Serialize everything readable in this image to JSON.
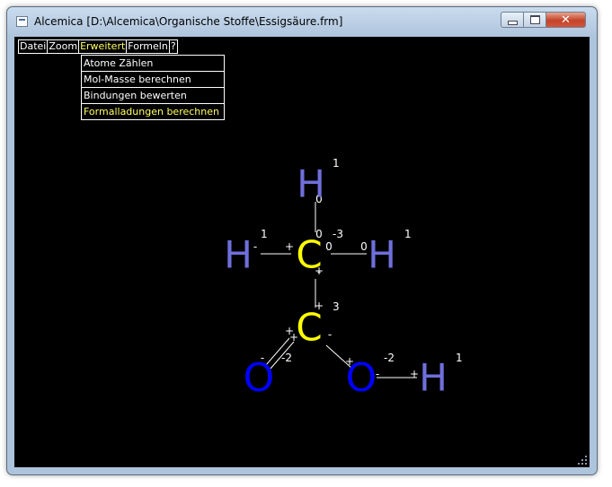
{
  "window": {
    "title": "Alcemica [D:\\Alcemica\\Organische Stoffe\\Essigsäure.frm]",
    "controls": {
      "minimize": "minimize",
      "maximize": "maximize",
      "close": "✕"
    }
  },
  "menu": {
    "items": [
      "Datei",
      "Zoom",
      "Erweitert",
      "Formeln",
      "?"
    ],
    "active": "Erweitert",
    "dropdown": [
      "Atome Zählen",
      "Mol-Masse berechnen",
      "Bindungen bewerten",
      "Formalladungen berechnen"
    ],
    "dropdown_highlight": "Formalladungen berechnen"
  },
  "colors": {
    "hydrogen": "#6f6fdc",
    "carbon": "#ffff00",
    "oxygen": "#0000ff",
    "bond": "#ffffff",
    "annotation": "#ffffff",
    "menu_highlight": "#ffff66"
  },
  "molecule": {
    "atoms": [
      {
        "symbol": "H",
        "element": "hydrogen",
        "charge": "1"
      },
      {
        "symbol": "H",
        "element": "hydrogen",
        "charge": "1"
      },
      {
        "symbol": "C",
        "element": "carbon",
        "charge": "-3"
      },
      {
        "symbol": "H",
        "element": "hydrogen",
        "charge": "1"
      },
      {
        "symbol": "C",
        "element": "carbon",
        "charge": "3"
      },
      {
        "symbol": "O",
        "element": "oxygen",
        "charge": "-2"
      },
      {
        "symbol": "O",
        "element": "oxygen",
        "charge": "-2"
      },
      {
        "symbol": "H",
        "element": "hydrogen",
        "charge": "1"
      }
    ],
    "bond_marks": [
      "0",
      "0",
      "+",
      "-",
      "-",
      "+",
      "0",
      "0",
      "+",
      "+",
      "+",
      "-",
      "-",
      "+",
      "-",
      "+"
    ]
  }
}
